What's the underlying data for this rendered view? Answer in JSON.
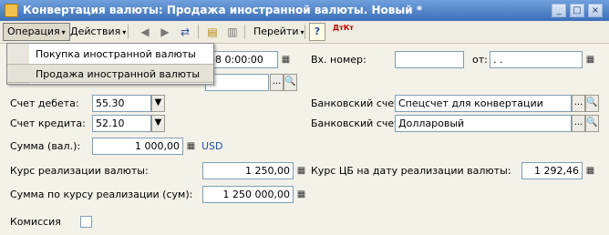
{
  "window": {
    "title": "Конвертация валюты: Продажа иностранной валюты. Новый *",
    "min_glyph": "_",
    "max_glyph": "□",
    "close_glyph": "×"
  },
  "toolbar": {
    "operation_label": "Операция",
    "actions_label": "Действия",
    "goto_label": "Перейти",
    "help_glyph": "?",
    "dt_kt_label": "ДтКт",
    "caret": "▾",
    "icons": [
      "back-icon",
      "forward-icon",
      "refresh-icon",
      "post-document-icon",
      "unpost-document-icon",
      "help-icon",
      "dt-kt-icon"
    ]
  },
  "menu": {
    "items": [
      {
        "label": "Покупка иностранной валюты"
      },
      {
        "label": "Продажа иностранной валюты"
      }
    ]
  },
  "form": {
    "date_value": "08  0:00:00",
    "incoming_number_label": "Вх. номер:",
    "incoming_number_value": "",
    "incoming_from_label": "от:",
    "incoming_from_value": " .  .",
    "debit_account_label": "Счет дебета:",
    "debit_account_value": "55.30",
    "credit_account_label": "Счет кредита:",
    "credit_account_value": "52.10",
    "bank_account_1_label": "Банковский счет:",
    "bank_account_1_value": "Спецсчет для конвертации",
    "bank_account_2_label": "Банковский счет:",
    "bank_account_2_value": "Долларовый",
    "amount_label": "Сумма (вал.):",
    "amount_value": "1 000,00",
    "currency": "USD",
    "sale_rate_label": "Курс реализации валюты:",
    "sale_rate_value": "1 250,00",
    "cb_rate_label": "Курс ЦБ на дату реализации валюты:",
    "cb_rate_value": "1 292,46",
    "sale_amount_label": "Сумма по курсу реализации (сум):",
    "sale_amount_value": "1 250 000,00",
    "commission_label": "Комиссия",
    "commission_checked": false,
    "select_glyph": "...",
    "search_glyph": "🔍",
    "dropdown_glyph": "▼",
    "calc_glyph": "▦"
  },
  "colors": {
    "title_bar": "#3d6fb8",
    "form_bg": "#f3f1e8",
    "currency_text": "#1f4fa8"
  }
}
